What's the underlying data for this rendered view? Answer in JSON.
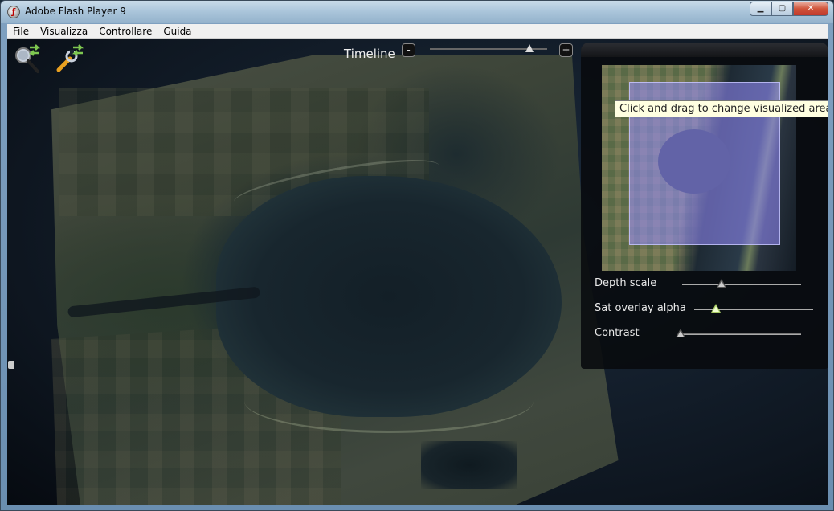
{
  "window": {
    "title": "Adobe Flash Player 9"
  },
  "menu": {
    "items": [
      "File",
      "Visualizza",
      "Controllare",
      "Guida"
    ]
  },
  "toolbar": {
    "timeline_label": "Timeline",
    "minus_label": "-",
    "plus_label": "+",
    "timeline_value": 0.85,
    "search_icon": "search-swap-icon",
    "settings_icon": "wrench-swap-icon"
  },
  "minimap": {
    "tooltip": "Click and drag to change visualized area."
  },
  "controls": {
    "sliders": [
      {
        "label": "Depth scale",
        "value": 0.33
      },
      {
        "label": "Sat overlay alpha",
        "value": 0.18
      },
      {
        "label": "Contrast",
        "value": 0.0
      }
    ]
  },
  "colors": {
    "accent_slider": "#aacc66",
    "viewport_overlay": "#9690ff",
    "tooltip_bg": "#ffffe1"
  }
}
